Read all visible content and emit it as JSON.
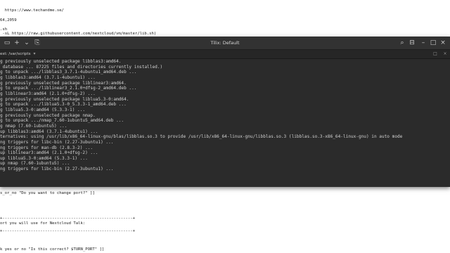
{
  "window": {
    "title": "Tilix: Default",
    "session_title": "est: /var/scripts",
    "session_dropdown": "▾",
    "buttons": {
      "terminal_menu": "▭",
      "add": "+",
      "split_down": "⌄",
      "save": "⎘",
      "search": "⌕",
      "notifications": "⊟",
      "minimize": "–",
      "maximize": "□",
      "close": "×",
      "session_close": "×",
      "session_maximize": "□"
    }
  },
  "background_lines": [
    "  https://www.techandme.se/",
    "",
    "",
    "64,2059",
    "",
    ".sh",
    " -sL https://raw.githubusercontent.com/nextcloud/vm/master/lib.sh)",
    "s_or_no \"Do you want to change port?\" ]]",
    "+-------------------------------------------------------+",
    "ort you will use for Nextcloud Talk:",
    "+-------------------------------------------------------+",
    "k yes or no \"Is this correct? $TURN_PORT\" ]]"
  ],
  "terminal": {
    "lines": [
      "g previously unselected package libblas3:amd64.",
      " database ... 87225 files and directories currently installed.)",
      "g to unpack .../libblas3_3.7.1-4ubuntu1_amd64.deb ...",
      "g libblas3:amd64 (3.7.1-4ubuntu1) ...",
      "g previously unselected package liblinear3:amd64.",
      "g to unpack .../liblinear3_2.1.0+dfsg-2_amd64.deb ...",
      "g liblinear3:amd64 (2.1.0+dfsg-2) ...",
      "g previously unselected package liblua5.3-0:amd64.",
      "g to unpack .../liblua5.3-0_5.3.3-1_amd64.deb ...",
      "g liblua5.3-0:amd64 (5.3.3-1) ...",
      "g previously unselected package nmap.",
      "g to unpack .../nmap_7.60-1ubuntu5_amd64.deb ...",
      "g nmap (7.60-1ubuntu5) ...",
      "up libblas3:amd64 (3.7.1-4ubuntu1) ...",
      "ternatives: using /usr/lib/x86_64-linux-gnu/blas/libblas.so.3 to provide /usr/lib/x86_64-linux-gnu/libblas.so.3 (libblas.so.3-x86_64-linux-gnu) in auto mode",
      "ng triggers for libc-bin (2.27-3ubuntu1) ...",
      "ng triggers for man-db (2.8.3-2) ...",
      "up liblinear3:amd64 (2.1.0+dfsg-2) ...",
      "up liblua5.3-0:amd64 (5.3.3-1) ...",
      "up nmap (7.60-1ubuntu5) ...",
      "ng triggers for libc-bin (2.27-3ubuntu1) ..."
    ]
  },
  "colors": {
    "terminal_bg": "#2b2b2b",
    "terminal_fg": "#d0d0d0",
    "titlebar_bg": "#323232"
  }
}
